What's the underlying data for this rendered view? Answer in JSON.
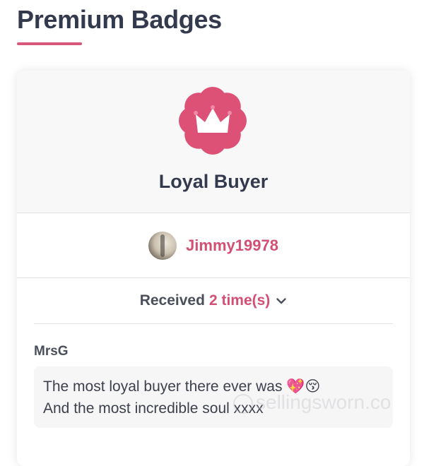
{
  "page": {
    "title": "Premium Badges",
    "accent_color": "#d8577a"
  },
  "badge": {
    "name": "Loyal Buyer",
    "icon": "crown-badge-icon",
    "icon_color": "#de5177"
  },
  "recipient": {
    "username": "Jimmy19978",
    "avatar": "avatar"
  },
  "received": {
    "label": "Received",
    "count_text": "2 time(s)",
    "toggle_icon": "chevron-down-icon"
  },
  "comments": [
    {
      "author": "MrsG",
      "line1": "The most loyal buyer there ever was 💖😚",
      "line2": "And the most incredible soul xxxx"
    }
  ],
  "watermark": {
    "text": "sellingsworn.co"
  }
}
